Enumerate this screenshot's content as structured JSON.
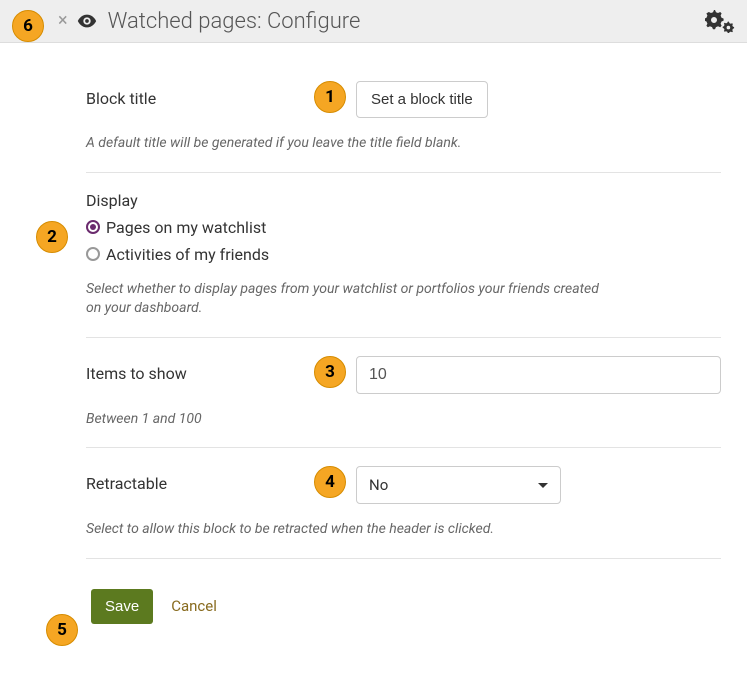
{
  "header": {
    "title": "Watched pages: Configure"
  },
  "blockTitle": {
    "label": "Block title",
    "button": "Set a block title",
    "help": "A default title will be generated if you leave the title field blank."
  },
  "display": {
    "label": "Display",
    "options": [
      {
        "label": "Pages on my watchlist",
        "selected": true
      },
      {
        "label": "Activities of my friends",
        "selected": false
      }
    ],
    "help": "Select whether to display pages from your watchlist or portfolios your friends created on your dashboard."
  },
  "itemsToShow": {
    "label": "Items to show",
    "value": "10",
    "help": "Between 1 and 100"
  },
  "retractable": {
    "label": "Retractable",
    "value": "No",
    "help": "Select to allow this block to be retracted when the header is clicked."
  },
  "actions": {
    "save": "Save",
    "cancel": "Cancel"
  },
  "callouts": {
    "c1": "1",
    "c2": "2",
    "c3": "3",
    "c4": "4",
    "c5": "5",
    "c6": "6"
  }
}
